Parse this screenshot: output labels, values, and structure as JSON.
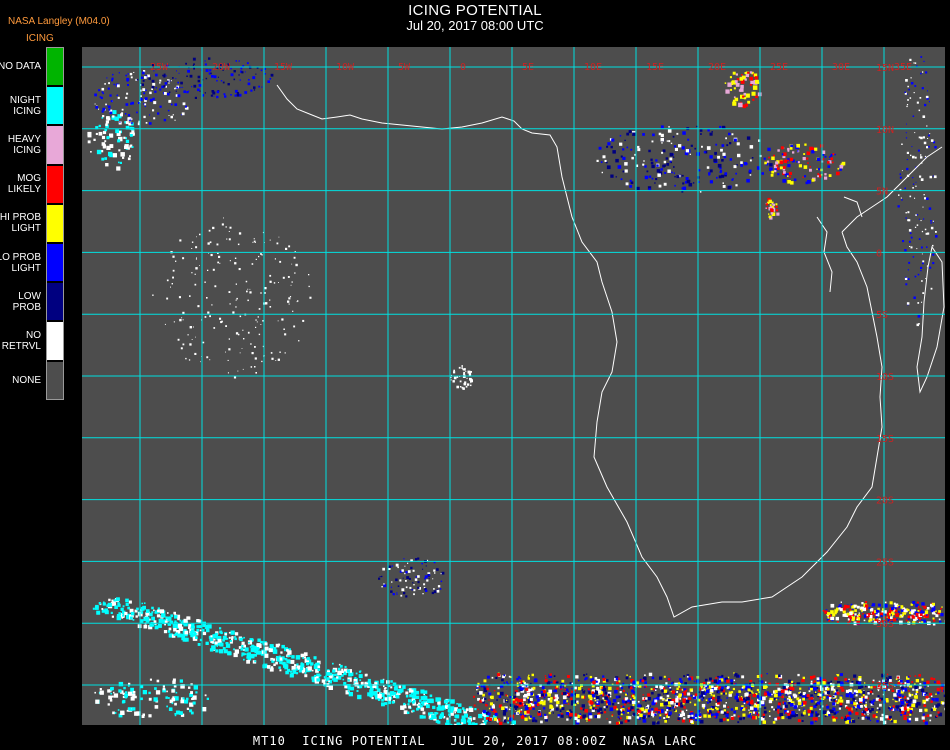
{
  "header": {
    "title": "ICING POTENTIAL",
    "subtitle": "Jul 20, 2017 08:00 UTC",
    "product": "NASA Langley (M04.0)"
  },
  "legend": {
    "title": "ICING",
    "items": [
      {
        "label": "NO DATA",
        "color": "#00b400"
      },
      {
        "label": "NIGHT\nICING",
        "color": "#00ffff"
      },
      {
        "label": "HEAVY\nICING",
        "color": "#e8a8d8"
      },
      {
        "label": "MOG\nLIKELY",
        "color": "#ff0000"
      },
      {
        "label": "HI PROB\nLIGHT",
        "color": "#ffff00"
      },
      {
        "label": "LO PROB\nLIGHT",
        "color": "#0000ff"
      },
      {
        "label": "LOW\nPROB",
        "color": "#000080"
      },
      {
        "label": "NO\nRETRVL",
        "color": "#ffffff"
      },
      {
        "label": "NONE",
        "color": "#4d4d4d"
      }
    ]
  },
  "map": {
    "background_color": "#4d4d4d",
    "grid_color": "#00e0e0",
    "coastline_color": "#ffffff",
    "label_color": "#cc2222",
    "lon_labels": [
      "25W",
      "20W",
      "15W",
      "10W",
      "5W",
      "0",
      "5E",
      "10E",
      "15E",
      "20E",
      "25E",
      "30E",
      "35E"
    ],
    "lat_labels": [
      "15N",
      "10N",
      "5N",
      "0",
      "5S",
      "10S",
      "15S",
      "20S",
      "25S",
      "30S",
      "35S",
      "40S"
    ]
  },
  "footer": {
    "text": "MT10  ICING POTENTIAL   JUL 20, 2017 08:00Z  NASA LARC"
  }
}
